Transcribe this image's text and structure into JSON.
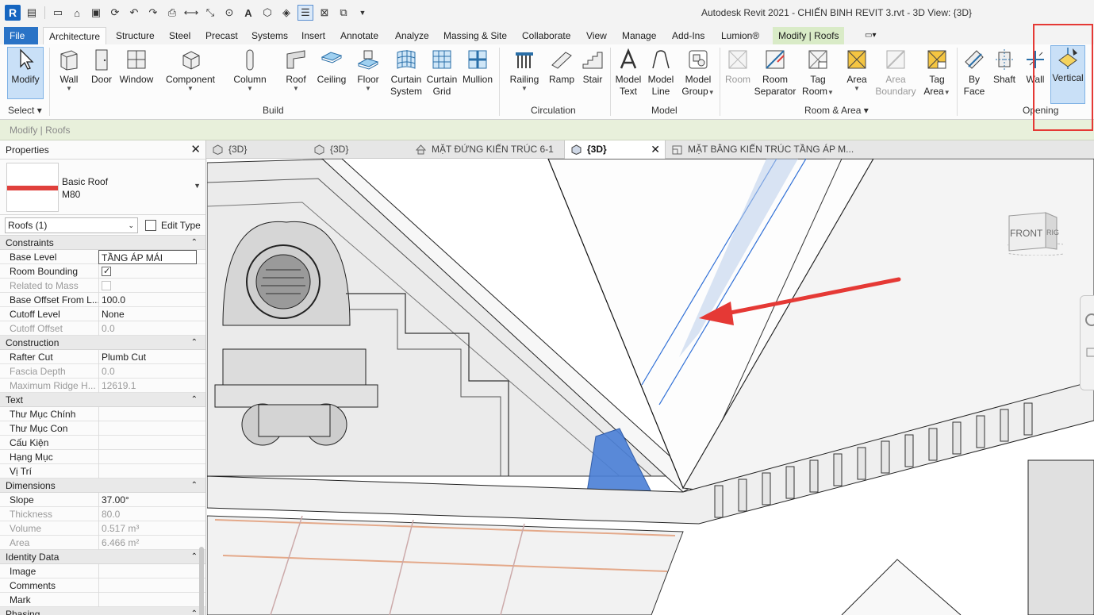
{
  "window": {
    "title": "Autodesk Revit 2021 - CHIẾN BINH REVIT 3.rvt - 3D View: {3D}"
  },
  "qat": {
    "logo": "R",
    "text_tool": "A"
  },
  "ribbon_tabs": [
    {
      "label": "File"
    },
    {
      "label": "Architecture"
    },
    {
      "label": "Structure"
    },
    {
      "label": "Steel"
    },
    {
      "label": "Precast"
    },
    {
      "label": "Systems"
    },
    {
      "label": "Insert"
    },
    {
      "label": "Annotate"
    },
    {
      "label": "Analyze"
    },
    {
      "label": "Massing & Site"
    },
    {
      "label": "Collaborate"
    },
    {
      "label": "View"
    },
    {
      "label": "Manage"
    },
    {
      "label": "Add-Ins"
    },
    {
      "label": "Lumion®"
    },
    {
      "label": "Modify | Roofs"
    }
  ],
  "ribbon": {
    "select": {
      "modify": "Modify",
      "panel": "Select"
    },
    "build": {
      "panel": "Build",
      "wall": "Wall",
      "door": "Door",
      "window": "Window",
      "component": "Component",
      "column": "Column",
      "roof": "Roof",
      "ceiling": "Ceiling",
      "floor": "Floor",
      "curtain_system_1": "Curtain",
      "curtain_system_2": "System",
      "curtain_grid_1": "Curtain",
      "curtain_grid_2": "Grid",
      "mullion": "Mullion"
    },
    "circulation": {
      "panel": "Circulation",
      "railing": "Railing",
      "ramp": "Ramp",
      "stair": "Stair"
    },
    "model": {
      "panel": "Model",
      "model_text_1": "Model",
      "model_text_2": "Text",
      "model_line_1": "Model",
      "model_line_2": "Line",
      "model_group_1": "Model",
      "model_group_2": "Group"
    },
    "room_area": {
      "panel": "Room & Area",
      "room": "Room",
      "room_sep_1": "Room",
      "room_sep_2": "Separator",
      "tag_room_1": "Tag",
      "tag_room_2": "Room",
      "area": "Area",
      "area_boundary_1": "Area",
      "area_boundary_2": "Boundary",
      "tag_area_1": "Tag",
      "tag_area_2": "Area"
    },
    "opening": {
      "panel": "Opening",
      "by_face_1": "By",
      "by_face_2": "Face",
      "shaft": "Shaft",
      "wall": "Wall",
      "vertical": "Vertical"
    }
  },
  "options_bar": {
    "text": "Modify | Roofs"
  },
  "properties": {
    "title": "Properties",
    "type_family": "Basic Roof",
    "type_name": "M80",
    "instance_filter": "Roofs (1)",
    "edit_type": "Edit Type",
    "groups": {
      "constraints": "Constraints",
      "construction": "Construction",
      "text": "Text",
      "dimensions": "Dimensions",
      "identity": "Identity Data",
      "phasing": "Phasing"
    },
    "rows": {
      "base_level": {
        "label": "Base Level",
        "value": "TẦNG ÁP MÁI"
      },
      "room_bounding": {
        "label": "Room Bounding"
      },
      "related_to_mass": {
        "label": "Related to Mass"
      },
      "base_offset": {
        "label": "Base Offset From L...",
        "value": "100.0"
      },
      "cutoff_level": {
        "label": "Cutoff Level",
        "value": "None"
      },
      "cutoff_offset": {
        "label": "Cutoff Offset",
        "value": "0.0"
      },
      "rafter_cut": {
        "label": "Rafter Cut",
        "value": "Plumb Cut"
      },
      "fascia_depth": {
        "label": "Fascia Depth",
        "value": "0.0"
      },
      "max_ridge": {
        "label": "Maximum Ridge H...",
        "value": "12619.1"
      },
      "thu_muc_chinh": {
        "label": "Thư Mục Chính",
        "value": ""
      },
      "thu_muc_con": {
        "label": "Thư Mục Con",
        "value": ""
      },
      "cau_kien": {
        "label": "Cấu Kiện",
        "value": ""
      },
      "hang_muc": {
        "label": "Hạng Mục",
        "value": ""
      },
      "vi_tri": {
        "label": "Vị Trí",
        "value": ""
      },
      "slope": {
        "label": "Slope",
        "value": "37.00°"
      },
      "thickness": {
        "label": "Thickness",
        "value": "80.0"
      },
      "volume": {
        "label": "Volume",
        "value": "0.517 m³"
      },
      "area": {
        "label": "Area",
        "value": "6.466 m²"
      },
      "image": {
        "label": "Image",
        "value": ""
      },
      "comments": {
        "label": "Comments",
        "value": ""
      },
      "mark": {
        "label": "Mark",
        "value": ""
      }
    }
  },
  "view_tabs": [
    {
      "label": "{3D}"
    },
    {
      "label": "{3D}"
    },
    {
      "label": "MẶT ĐỨNG KIẾN TRÚC 6-1"
    },
    {
      "label": "{3D}"
    },
    {
      "label": "MẶT BẰNG KIẾN TRÚC TẦNG ÁP M..."
    }
  ],
  "viewcube": {
    "front": "FRONT",
    "right": "RIG"
  },
  "colors": {
    "file_tab": "#2a73c6",
    "context_tab": "#d9ebc7",
    "highlight_box": "#e53935",
    "arrow": "#e53935",
    "roof_selection": "#2f6fd6"
  }
}
